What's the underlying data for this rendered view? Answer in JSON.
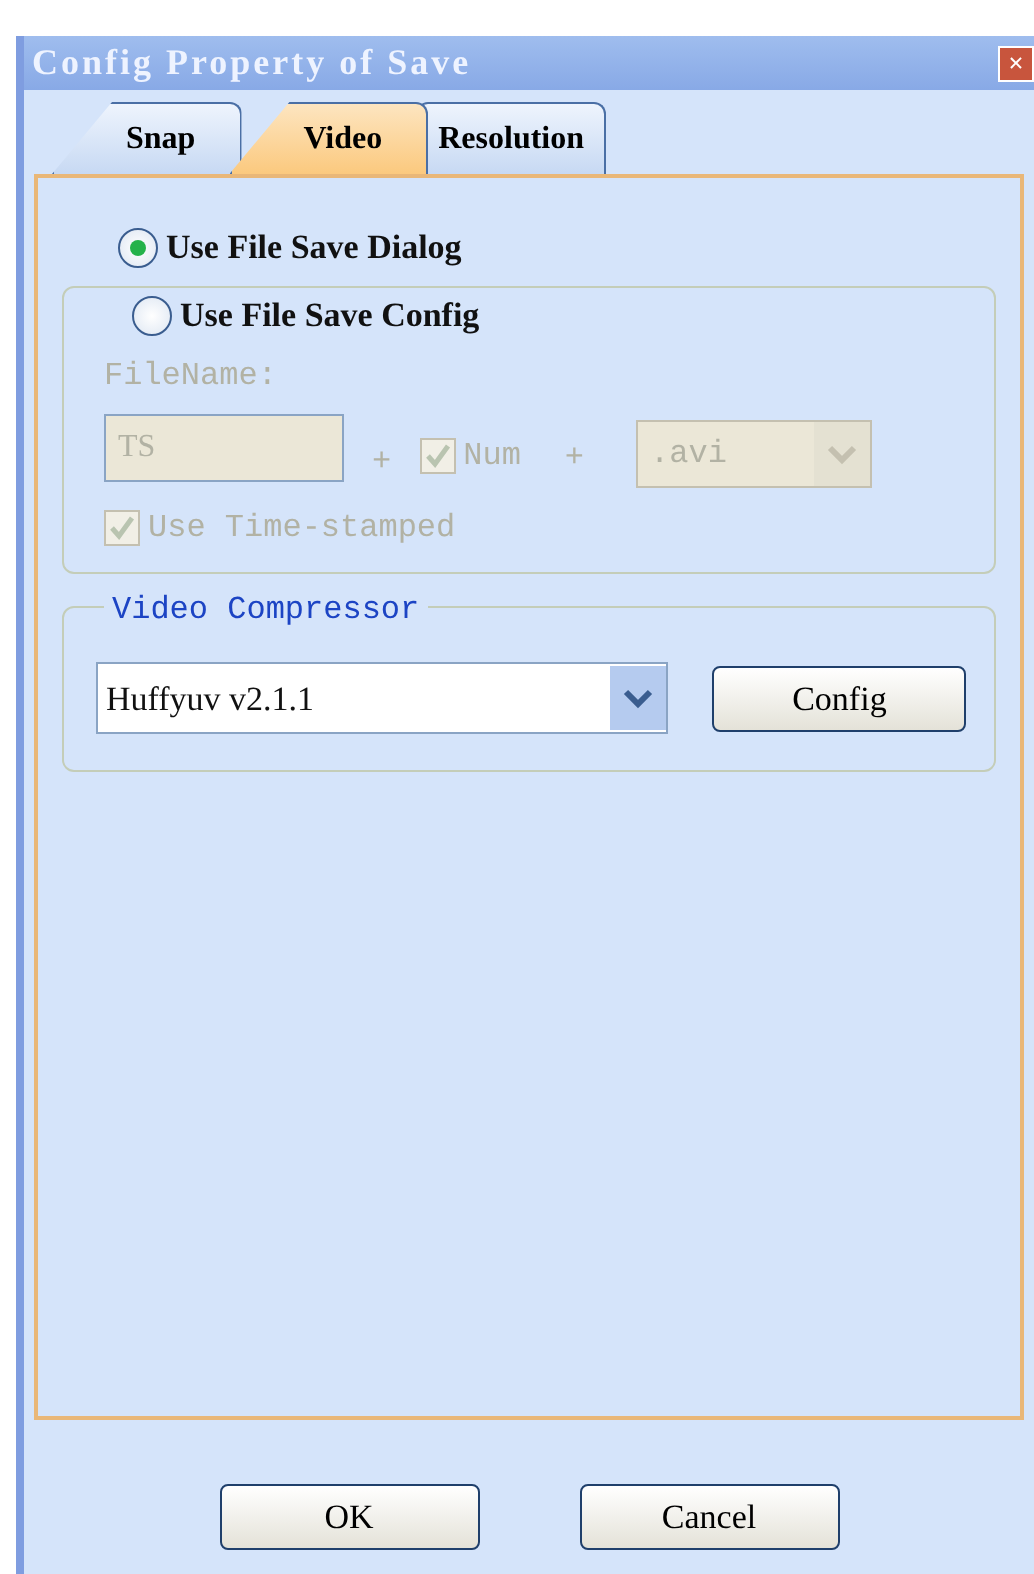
{
  "window": {
    "title": "Config Property of Save",
    "close": "✕"
  },
  "tabs": [
    {
      "label": "Snap",
      "selected": false
    },
    {
      "label": "Video",
      "selected": true
    },
    {
      "label": "Resolution",
      "selected": false
    }
  ],
  "save_mode": [
    {
      "label": "Use File Save Dialog",
      "selected": true
    },
    {
      "label": "Use File Save Config",
      "selected": false
    }
  ],
  "file_config": {
    "disabled": true,
    "filename_label": "FileName:",
    "filename_value": "TS",
    "plus_1": "+",
    "num": {
      "label": "Num",
      "checked": true
    },
    "plus_2": "+",
    "extension": ".avi",
    "timestamp": {
      "label": "Use Time-stamped",
      "checked": true
    }
  },
  "video_compressor": {
    "title": "Video Compressor",
    "codec": "Huffyuv v2.1.1",
    "config_button": "Config"
  },
  "buttons": [
    "OK",
    "Cancel"
  ]
}
